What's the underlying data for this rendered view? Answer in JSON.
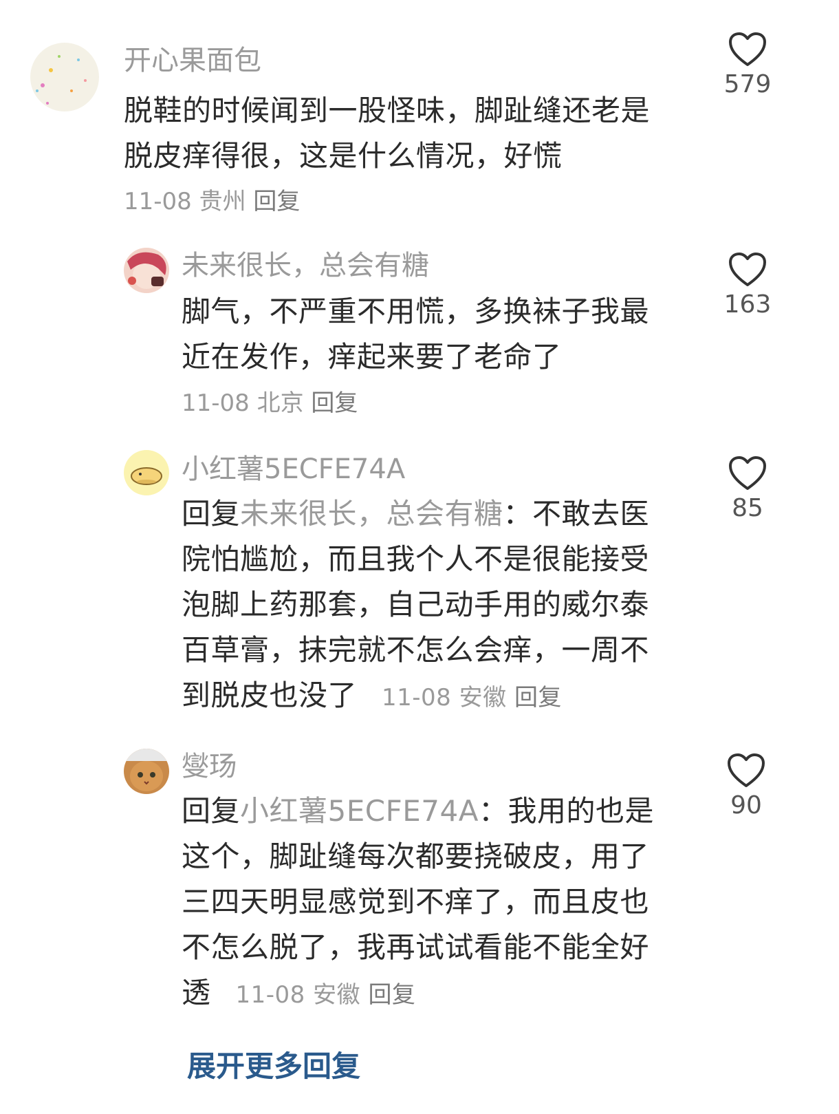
{
  "comments": [
    {
      "username": "开心果面包",
      "lines": [
        "脱鞋的时候闻到一股怪味，脚趾缝还老是",
        "脱皮痒得很，这是什么情况，好慌"
      ],
      "date": "11-08",
      "location": "贵州",
      "reply_label": "回复",
      "likes": "579"
    },
    {
      "username": "未来很长，总会有糖",
      "lines": [
        "脚气，不严重不用慌，多换袜子我最",
        "近在发作，痒起来要了老命了"
      ],
      "date": "11-08",
      "location": "北京",
      "reply_label": "回复",
      "likes": "163"
    },
    {
      "username": "小红薯5ECFE74A",
      "reply_prefix": "回复",
      "mention": "未来很长，总会有糖",
      "first_line_rest": "：不敢去医",
      "lines": [
        "院怕尴尬，而且我个人不是很能接受",
        "泡脚上药那套，自己动手用的威尔泰",
        "百草膏，抹完就不怎么会痒，一周不",
        "到脱皮也没了"
      ],
      "date": "11-08",
      "location": "安徽",
      "reply_label": "回复",
      "likes": "85"
    },
    {
      "username": "燮玚",
      "reply_prefix": "回复",
      "mention": "小红薯5ECFE74A",
      "first_line_rest": "：我用的也是",
      "lines": [
        "这个，脚趾缝每次都要挠破皮，用了",
        "三四天明显感觉到不痒了，而且皮也",
        "不怎么脱了，我再试试看能不能全好",
        "透"
      ],
      "date": "11-08",
      "location": "安徽",
      "reply_label": "回复",
      "likes": "90"
    }
  ],
  "expand_label": "展开更多回复",
  "colors": {
    "text": "#2b2b2b",
    "meta": "#9a9a9a",
    "link": "#2a5a8c"
  },
  "icons": [
    "heart-outline-icon"
  ]
}
